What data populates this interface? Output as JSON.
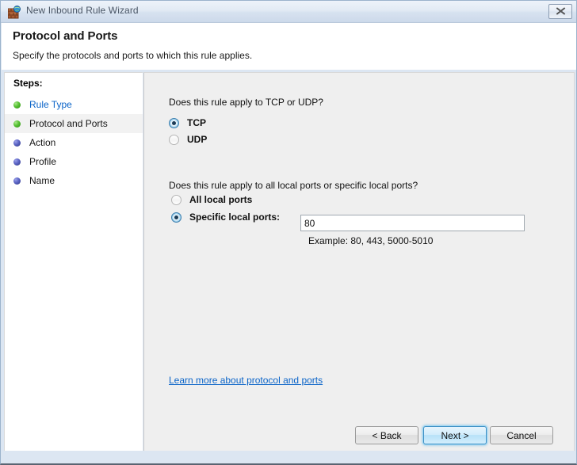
{
  "window": {
    "title": "New Inbound Rule Wizard",
    "icon": "firewall-globe-icon",
    "close_label": "✖"
  },
  "header": {
    "title": "Protocol and Ports",
    "subtitle": "Specify the protocols and ports to which this rule applies."
  },
  "sidebar": {
    "heading": "Steps:",
    "items": [
      {
        "label": "Rule Type",
        "state": "completed",
        "link": true,
        "current": false
      },
      {
        "label": "Protocol and Ports",
        "state": "completed",
        "link": false,
        "current": true
      },
      {
        "label": "Action",
        "state": "pending",
        "link": false,
        "current": false
      },
      {
        "label": "Profile",
        "state": "pending",
        "link": false,
        "current": false
      },
      {
        "label": "Name",
        "state": "pending",
        "link": false,
        "current": false
      }
    ]
  },
  "main": {
    "protocol_question": "Does this rule apply to TCP or UDP?",
    "protocol_options": [
      {
        "label": "TCP",
        "selected": true
      },
      {
        "label": "UDP",
        "selected": false
      }
    ],
    "ports_question": "Does this rule apply to all local ports or specific local ports?",
    "port_scope_options": [
      {
        "label": "All local ports",
        "selected": false
      },
      {
        "label": "Specific local ports:",
        "selected": true
      }
    ],
    "port_value": "80",
    "port_placeholder": "",
    "port_example": "Example: 80, 443, 5000-5010",
    "learn_more": "Learn more about protocol and ports"
  },
  "footer": {
    "back": "< Back",
    "next": "Next >",
    "cancel": "Cancel"
  },
  "colors": {
    "link": "#0b64c8",
    "accent": "#3c8fc4",
    "bullet_done": "#55c032",
    "bullet_pending": "#5a63c4",
    "window_frame": "#dce6f2",
    "content_bg": "#efefef"
  }
}
